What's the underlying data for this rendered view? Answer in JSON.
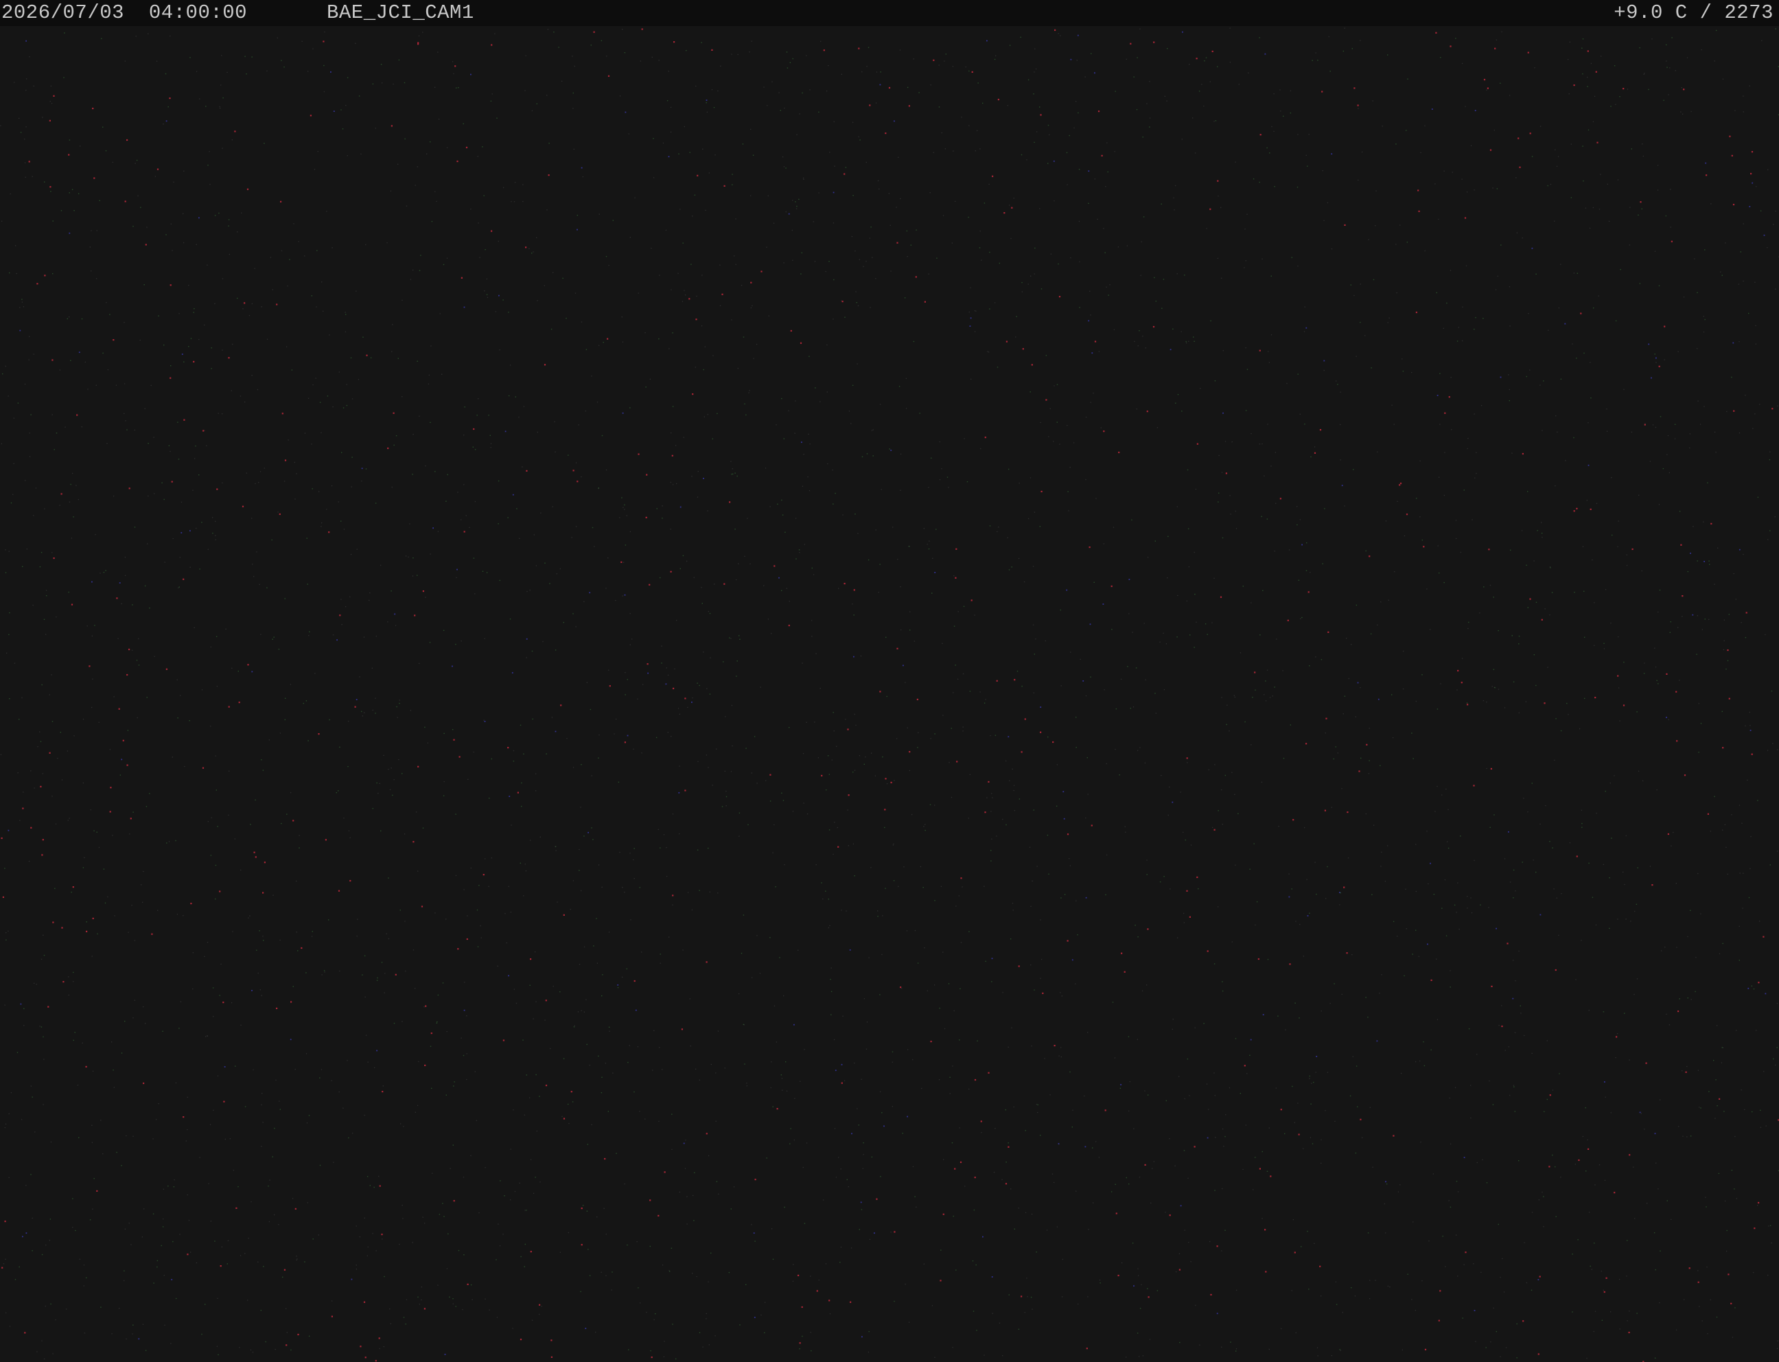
{
  "overlay": {
    "datetime": "2026/07/03  04:00:00",
    "camera_id": "BAE_JCI_CAM1",
    "reading": "+9.0 C / 2273"
  },
  "scene": {
    "description_colors": {
      "background": "#151515",
      "noise_red": "#b8283a",
      "noise_green": "#3a7a3a",
      "noise_blue": "#3a3ab0",
      "noise_gray": "#4a4a4a"
    }
  }
}
